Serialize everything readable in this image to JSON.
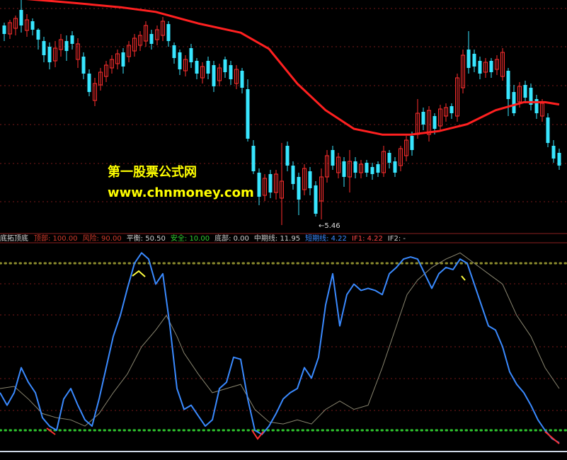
{
  "chart_data": [
    {
      "type": "candlestick",
      "title": "",
      "colors": {
        "up": "#ff2e2e",
        "down": "#38e6ff",
        "ma_line": "#ff2020",
        "grid": "#7a1a1a"
      },
      "ma_line": [
        {
          "x": 0,
          "y": 7.05
        },
        {
          "x": 100,
          "y": 7.0
        },
        {
          "x": 170,
          "y": 6.96
        },
        {
          "x": 220,
          "y": 6.92
        },
        {
          "x": 280,
          "y": 6.82
        },
        {
          "x": 340,
          "y": 6.74
        },
        {
          "x": 380,
          "y": 6.6
        },
        {
          "x": 420,
          "y": 6.3
        },
        {
          "x": 460,
          "y": 6.07
        },
        {
          "x": 500,
          "y": 5.91
        },
        {
          "x": 540,
          "y": 5.86
        },
        {
          "x": 580,
          "y": 5.86
        },
        {
          "x": 620,
          "y": 5.89
        },
        {
          "x": 660,
          "y": 5.95
        },
        {
          "x": 700,
          "y": 6.07
        },
        {
          "x": 740,
          "y": 6.14
        },
        {
          "x": 770,
          "y": 6.14
        },
        {
          "x": 790,
          "y": 6.12
        }
      ],
      "min_label": "←5.46",
      "watermark": [
        "第一股票公式网",
        "www.chnmoney.com"
      ]
    },
    {
      "type": "line",
      "title": "底拓顶底",
      "legend": [
        {
          "label": "顶部: 100.00",
          "color": "#d23a2a"
        },
        {
          "label": "风险: 90.00",
          "color": "#d23a2a"
        },
        {
          "label": "平衡: 50.50",
          "color": "#cfcfcf"
        },
        {
          "label": "安全: 10.00",
          "color": "#2fcf2f"
        },
        {
          "label": "底部: 0.00",
          "color": "#cfcfcf"
        },
        {
          "label": "中期线: 11.95",
          "color": "#cfcfcf"
        },
        {
          "label": "短期线: 4.22",
          "color": "#3a8aff"
        },
        {
          "label": "IF1: 4.22",
          "color": "#ff4444"
        },
        {
          "label": "IF2: -",
          "color": "#cfcfcf"
        }
      ],
      "levels": [
        {
          "name": "顶部",
          "value": 100
        },
        {
          "name": "风险",
          "value": 90
        },
        {
          "name": "平衡",
          "value": 50.5
        },
        {
          "name": "安全",
          "value": 10
        },
        {
          "name": "底部",
          "value": 0
        }
      ],
      "ylim": [
        0,
        100
      ],
      "series": [
        {
          "name": "短期线",
          "color": "#3a8aff",
          "points": [
            [
              0,
              28
            ],
            [
              10,
              22
            ],
            [
              20,
              28
            ],
            [
              30,
              40
            ],
            [
              40,
              33
            ],
            [
              50,
              28
            ],
            [
              60,
              16
            ],
            [
              70,
              12
            ],
            [
              80,
              10
            ],
            [
              90,
              25
            ],
            [
              100,
              30
            ],
            [
              110,
              22
            ],
            [
              120,
              15
            ],
            [
              130,
              12
            ],
            [
              140,
              25
            ],
            [
              150,
              40
            ],
            [
              160,
              55
            ],
            [
              170,
              65
            ],
            [
              180,
              78
            ],
            [
              190,
              90
            ],
            [
              200,
              95
            ],
            [
              210,
              92
            ],
            [
              220,
              80
            ],
            [
              230,
              85
            ],
            [
              240,
              60
            ],
            [
              250,
              30
            ],
            [
              260,
              20
            ],
            [
              270,
              22
            ],
            [
              280,
              17
            ],
            [
              290,
              12
            ],
            [
              300,
              15
            ],
            [
              310,
              30
            ],
            [
              320,
              33
            ],
            [
              330,
              45
            ],
            [
              340,
              44
            ],
            [
              350,
              25
            ],
            [
              360,
              10
            ],
            [
              370,
              8
            ],
            [
              380,
              12
            ],
            [
              390,
              18
            ],
            [
              400,
              25
            ],
            [
              410,
              28
            ],
            [
              420,
              30
            ],
            [
              430,
              40
            ],
            [
              440,
              35
            ],
            [
              450,
              45
            ],
            [
              460,
              70
            ],
            [
              470,
              85
            ],
            [
              480,
              60
            ],
            [
              490,
              75
            ],
            [
              500,
              80
            ],
            [
              510,
              77
            ],
            [
              520,
              78
            ],
            [
              530,
              77
            ],
            [
              540,
              75
            ],
            [
              550,
              85
            ],
            [
              560,
              88
            ],
            [
              570,
              92
            ],
            [
              580,
              93
            ],
            [
              590,
              92
            ],
            [
              600,
              85
            ],
            [
              610,
              78
            ],
            [
              620,
              85
            ],
            [
              630,
              88
            ],
            [
              640,
              87
            ],
            [
              650,
              92
            ],
            [
              660,
              90
            ],
            [
              670,
              80
            ],
            [
              680,
              70
            ],
            [
              690,
              60
            ],
            [
              700,
              58
            ],
            [
              710,
              50
            ],
            [
              720,
              38
            ],
            [
              730,
              32
            ],
            [
              740,
              28
            ],
            [
              750,
              22
            ],
            [
              760,
              15
            ],
            [
              770,
              10
            ],
            [
              780,
              6
            ],
            [
              790,
              4
            ]
          ]
        },
        {
          "name": "中期线",
          "color": "#8a8670",
          "points": [
            [
              0,
              30
            ],
            [
              20,
              31
            ],
            [
              40,
              25
            ],
            [
              60,
              18
            ],
            [
              80,
              16
            ],
            [
              100,
              15
            ],
            [
              120,
              12
            ],
            [
              140,
              18
            ],
            [
              160,
              28
            ],
            [
              180,
              37
            ],
            [
              200,
              50
            ],
            [
              220,
              58
            ],
            [
              235,
              65
            ],
            [
              250,
              55
            ],
            [
              260,
              47
            ],
            [
              280,
              37
            ],
            [
              300,
              28
            ],
            [
              320,
              30
            ],
            [
              340,
              32
            ],
            [
              360,
              20
            ],
            [
              380,
              14
            ],
            [
              400,
              13
            ],
            [
              420,
              15
            ],
            [
              440,
              13
            ],
            [
              460,
              20
            ],
            [
              480,
              24
            ],
            [
              500,
              20
            ],
            [
              520,
              22
            ],
            [
              540,
              40
            ],
            [
              560,
              60
            ],
            [
              575,
              75
            ],
            [
              590,
              82
            ],
            [
              610,
              88
            ],
            [
              630,
              92
            ],
            [
              650,
              95
            ],
            [
              670,
              90
            ],
            [
              690,
              85
            ],
            [
              710,
              80
            ],
            [
              730,
              65
            ],
            [
              750,
              55
            ],
            [
              770,
              40
            ],
            [
              790,
              30
            ]
          ]
        }
      ]
    }
  ]
}
